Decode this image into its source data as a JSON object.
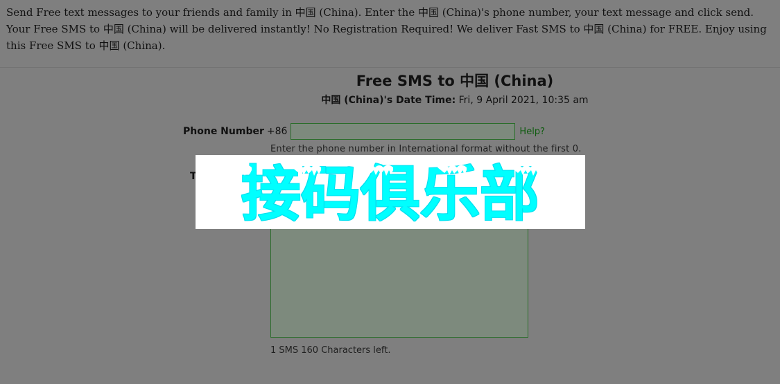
{
  "intro": {
    "text": "Send Free text messages to your friends and family in 中国 (China). Enter the 中国 (China)'s phone number, your text message and click send. Your Free SMS to 中国 (China) will be delivered instantly! No Registration Required! We deliver Fast SMS to 中国 (China) for FREE. Enjoy using this Free SMS to 中国 (China)."
  },
  "header": {
    "title": "Free SMS to 中国 (China)",
    "datetime_label": "中国 (China)'s Date Time:",
    "datetime_value": "Fri, 9 April 2021, 10:35 am"
  },
  "form": {
    "phone_label": "Phone Number",
    "country_code": "+86",
    "phone_value": "",
    "help_label": "Help?",
    "phone_hint": "Enter the phone number in International format without the first 0.",
    "text_label": "T",
    "message_value": "",
    "sms_count": "1 SMS 160 Characters left."
  },
  "watermark": {
    "text": "接码俱乐部",
    "color": "#00ffff"
  },
  "colors": {
    "page_bg": "#7f7f7f",
    "input_border": "#2a6e2a",
    "input_bg": "#7d8a7d",
    "link": "#0f5c0f"
  }
}
